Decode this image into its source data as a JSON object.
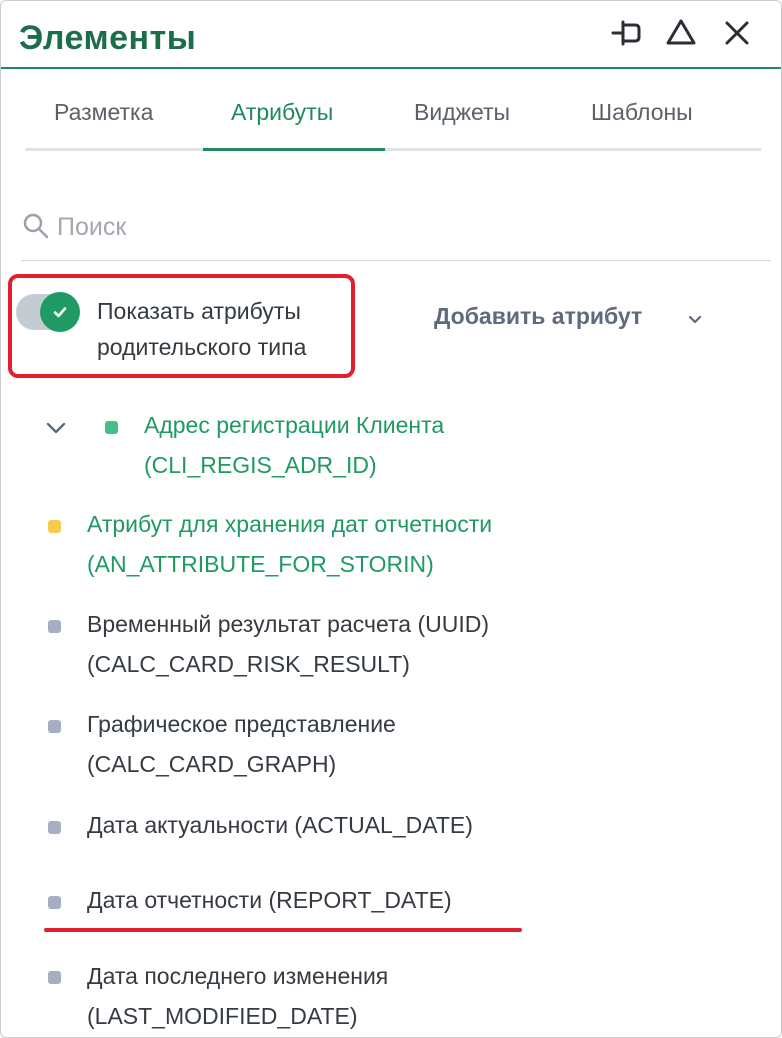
{
  "header": {
    "title": "Элементы",
    "icons": [
      "pin-icon",
      "collapse-up-icon",
      "close-icon"
    ],
    "accent_color": "#1f8a5b"
  },
  "tabs": [
    {
      "label": "Разметка",
      "active": false
    },
    {
      "label": "Атрибуты",
      "active": true
    },
    {
      "label": "Виджеты",
      "active": false
    },
    {
      "label": "Шаблоны",
      "active": false
    }
  ],
  "search": {
    "placeholder": "Поиск",
    "value": ""
  },
  "toggle": {
    "label": "Показать атрибуты родительского типа",
    "checked": true
  },
  "add_attribute": {
    "label": "Добавить атрибут"
  },
  "attributes": [
    {
      "name": "Адрес регистрации Клиента",
      "code": "(CLI_REGIS_ADR_ID)",
      "status_color": "#41c08a",
      "expandable": true
    },
    {
      "name": "Атрибут для хранения дат отчетности",
      "code": "(AN_ATTRIBUTE_FOR_STORIN)",
      "status_color": "#f5cc4c"
    },
    {
      "name": "Временный результат расчета (UUID)",
      "code": "(CALC_CARD_RISK_RESULT)",
      "status_color": "#a5b1c2"
    },
    {
      "name": "Графическое представление",
      "code": "(CALC_CARD_GRAPH)",
      "status_color": "#a5b1c2"
    },
    {
      "name": "Дата актуальности (ACTUAL_DATE)",
      "status_color": "#a5b1c2"
    },
    {
      "name": "Дата отчетности (REPORT_DATE)",
      "status_color": "#a5b1c2"
    },
    {
      "name": "Дата последнего изменения",
      "code": "(LAST_MODIFIED_DATE)",
      "status_color": "#a5b1c2"
    }
  ]
}
